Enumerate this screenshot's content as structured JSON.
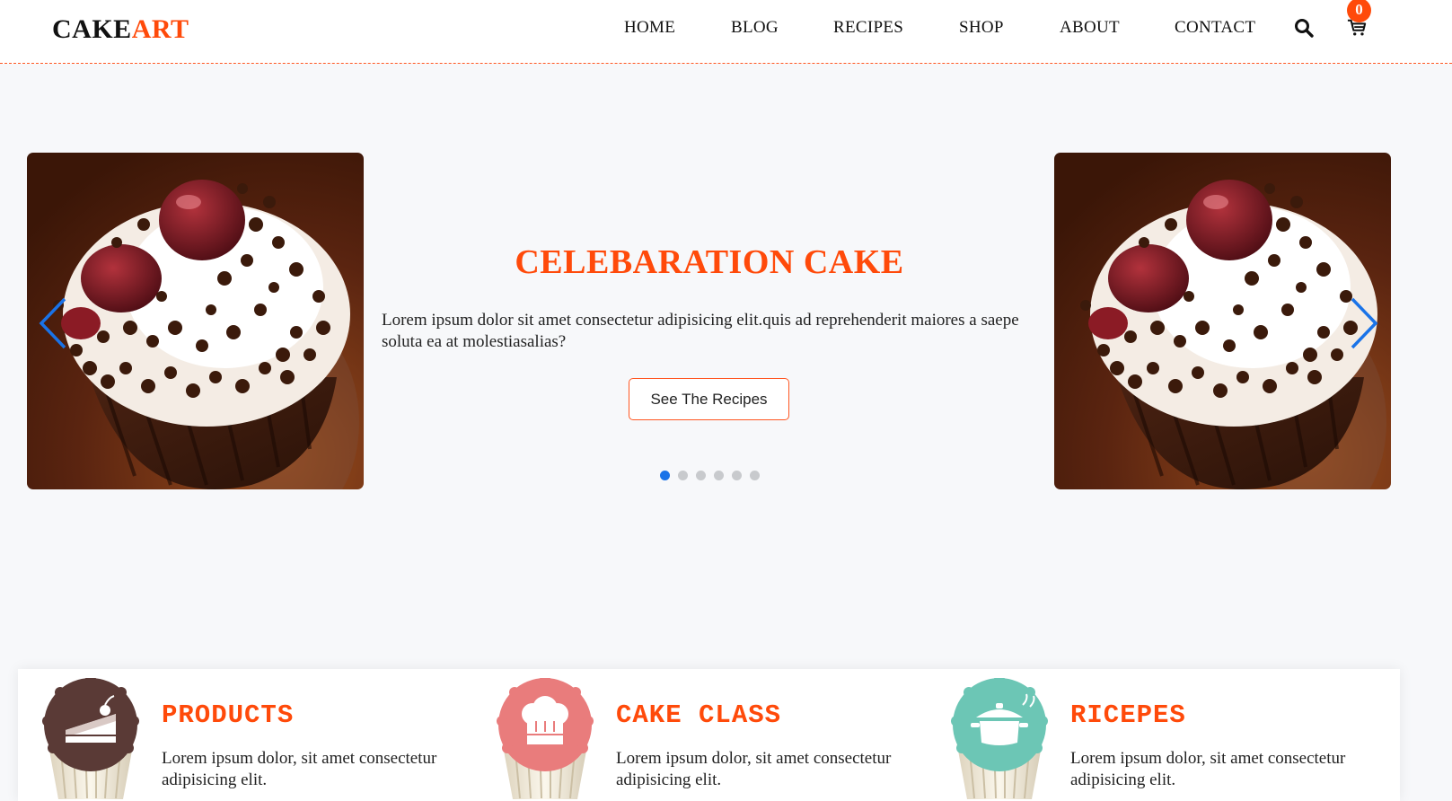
{
  "brand": {
    "part1": "CAKE",
    "part2": "ART",
    "accent_color": "#ff4a0a"
  },
  "nav": {
    "items": [
      "HOME",
      "BLOG",
      "RECIPES",
      "SHOP",
      "ABOUT",
      "CONTACT"
    ]
  },
  "header_icons": {
    "search": "search-icon",
    "cart": "cart-icon",
    "cart_count": "0"
  },
  "hero": {
    "title": "CELEBARATION CAKE",
    "text": "Lorem ipsum dolor sit amet consectetur adipisicing elit.quis ad reprehenderit maiores a saepe soluta ea at molestiasalias?",
    "button_label": "See The Recipes",
    "slide_count": 6,
    "active_slide": 1,
    "active_dot_color": "#1a73e8"
  },
  "features": [
    {
      "title": "PRODUCTS",
      "text": "Lorem ipsum dolor, sit amet consectetur adipisicing elit.",
      "icon": "cake-slice-icon",
      "color": "#5a3a36"
    },
    {
      "title": "CAKE CLASS",
      "text": "Lorem ipsum dolor, sit amet consectetur adipisicing elit.",
      "icon": "chef-hat-icon",
      "color": "#e97c7c"
    },
    {
      "title": "RICEPES",
      "text": "Lorem ipsum dolor, sit amet consectetur adipisicing elit.",
      "icon": "cooking-pot-icon",
      "color": "#6cc6b5"
    }
  ]
}
